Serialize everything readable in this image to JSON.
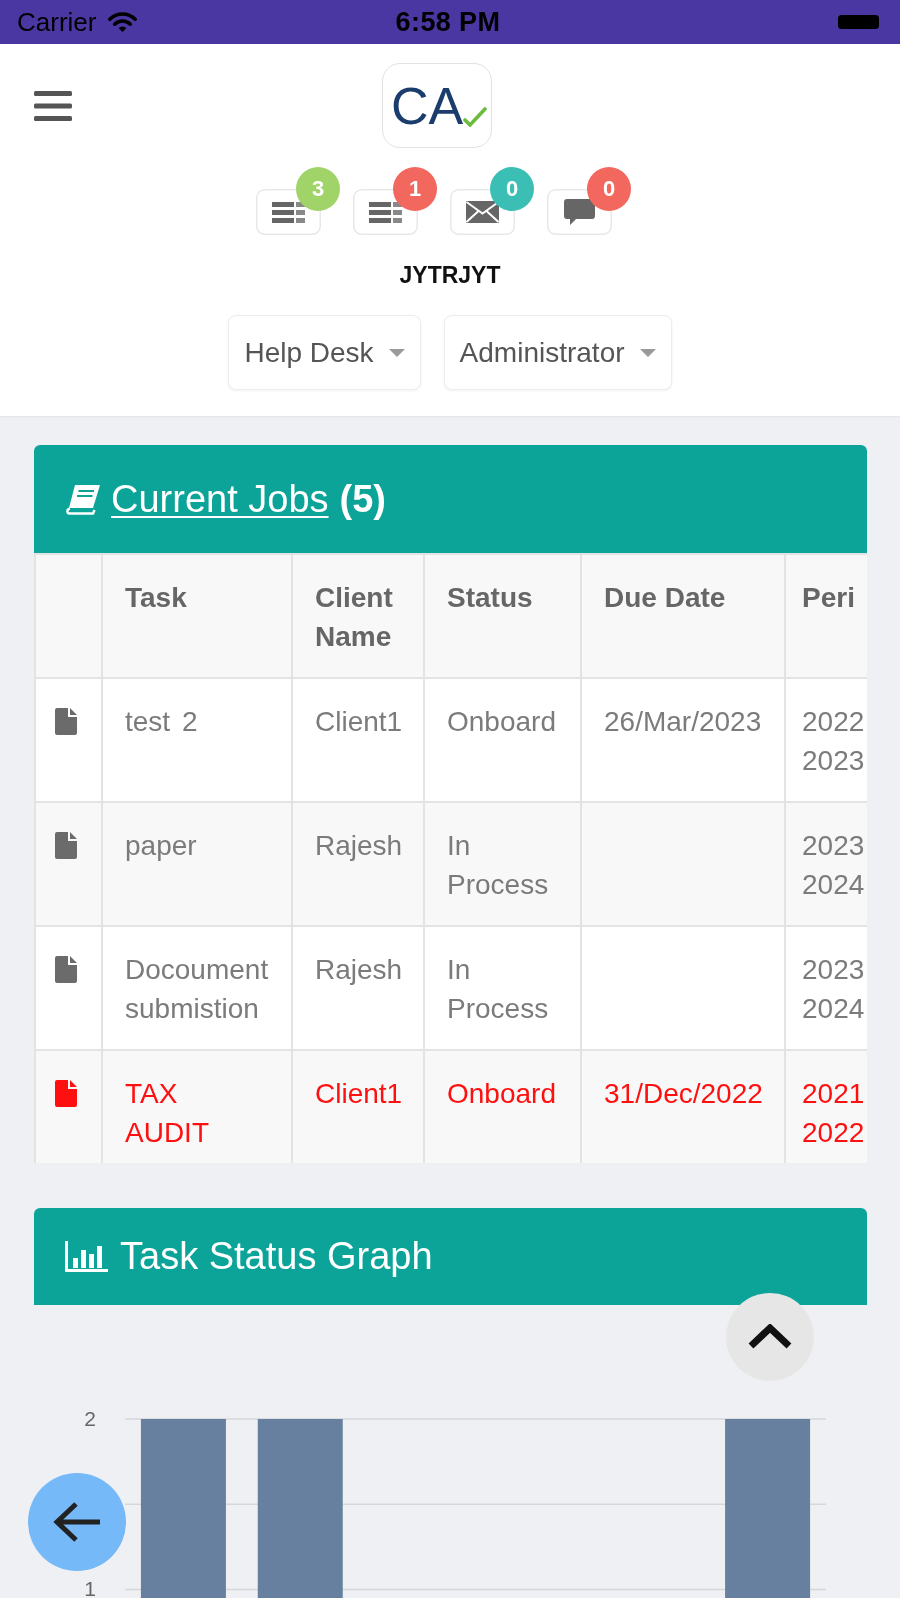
{
  "status_bar": {
    "carrier": "Carrier",
    "time": "6:58 PM"
  },
  "header": {
    "logo": {
      "text": "CA"
    },
    "shortcuts": [
      {
        "kind": "tasks",
        "count": "3",
        "color": "#a0d468"
      },
      {
        "kind": "tasks",
        "count": "1",
        "color": "#f2675e"
      },
      {
        "kind": "mail",
        "count": "0",
        "color": "#3bbfb5"
      },
      {
        "kind": "chat",
        "count": "0",
        "color": "#f2675e"
      }
    ],
    "user_name": "JYTRJYT",
    "dropdowns": [
      {
        "value": "Help Desk"
      },
      {
        "value": "Administrator"
      }
    ]
  },
  "current_jobs": {
    "title": "Current Jobs",
    "count": "(5)",
    "columns": [
      "Task",
      "Client Name",
      "Status",
      "Due Date",
      "Peri"
    ],
    "rows": [
      {
        "task": "test 2",
        "client_name": "Client1",
        "status": "Onboard",
        "due_date": "26/Mar/2023",
        "column_6": "2022 2023",
        "overdue": false
      },
      {
        "task": "paper",
        "client_name": "Rajesh",
        "status": "In Process",
        "column_6": "2023 2024",
        "overdue": false
      },
      {
        "task": "Docoument submistion",
        "client_name": "Rajesh",
        "status": "In Process",
        "column_6": "2023 2024",
        "overdue": false
      },
      {
        "task": "TAX AUDIT",
        "client_name": "Client1",
        "status": "Onboard",
        "due_date": "31/Dec/2022",
        "column_6": "2021 2022",
        "overdue": true
      }
    ]
  },
  "task_status_graph": {
    "title": "Task Status Graph",
    "chart_data": {
      "type": "bar",
      "values": [
        2,
        2,
        null,
        null,
        null,
        2
      ],
      "ylim": [
        0.95,
        2
      ],
      "yticks": [
        1,
        2
      ]
    }
  }
}
